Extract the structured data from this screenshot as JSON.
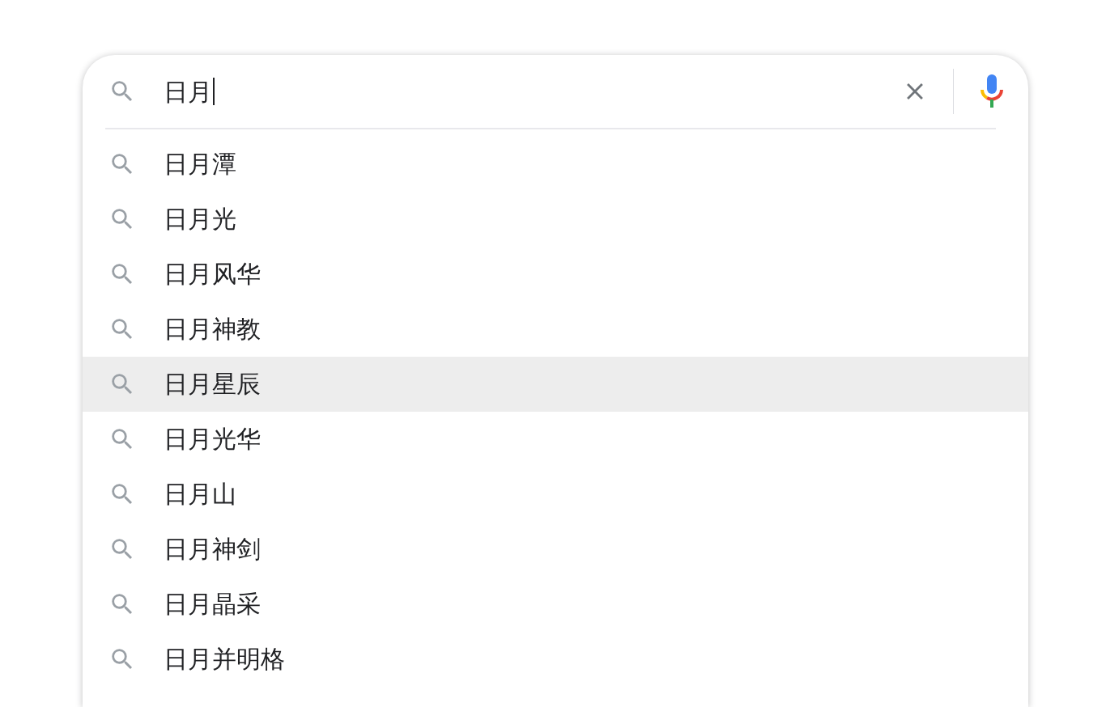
{
  "search": {
    "value": "日月",
    "caret": true
  },
  "suggestions": [
    {
      "text": "日月潭",
      "selected": false
    },
    {
      "text": "日月光",
      "selected": false
    },
    {
      "text": "日月风华",
      "selected": false
    },
    {
      "text": "日月神教",
      "selected": false
    },
    {
      "text": "日月星辰",
      "selected": true
    },
    {
      "text": "日月光华",
      "selected": false
    },
    {
      "text": "日月山",
      "selected": false
    },
    {
      "text": "日月神剑",
      "selected": false
    },
    {
      "text": "日月晶采",
      "selected": false
    },
    {
      "text": "日月并明格",
      "selected": false
    }
  ]
}
